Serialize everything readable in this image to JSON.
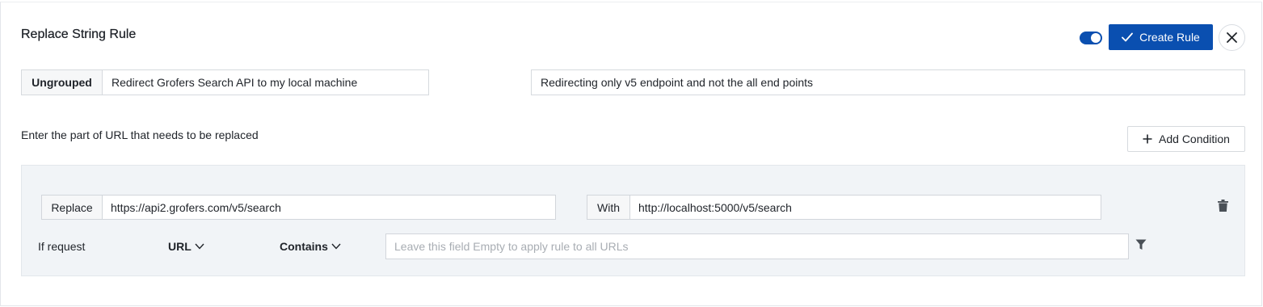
{
  "rule": {
    "title": "Replace String Rule",
    "enabled": true,
    "create_label": "Create Rule",
    "group_label": "Ungrouped",
    "name_value": "Redirect Grofers Search API to my local machine",
    "description_value": "Redirecting only v5 endpoint and not the all end points"
  },
  "section": {
    "label": "Enter the part of URL that needs to be replaced",
    "add_condition_label": "Add Condition"
  },
  "pair": {
    "replace_label": "Replace",
    "replace_value": "https://api2.grofers.com/v5/search",
    "with_label": "With",
    "with_value": "http://localhost:5000/v5/search",
    "if_label": "If request",
    "source_key": "URL",
    "operator": "Contains",
    "source_placeholder": "Leave this field Empty to apply rule to all URLs"
  },
  "colors": {
    "accent": "#0a4fb0",
    "panel": "#f1f4f7"
  },
  "icons": [
    "check-icon",
    "close-icon",
    "plus-icon",
    "trash-icon",
    "chevron-down-icon",
    "filter-icon"
  ]
}
